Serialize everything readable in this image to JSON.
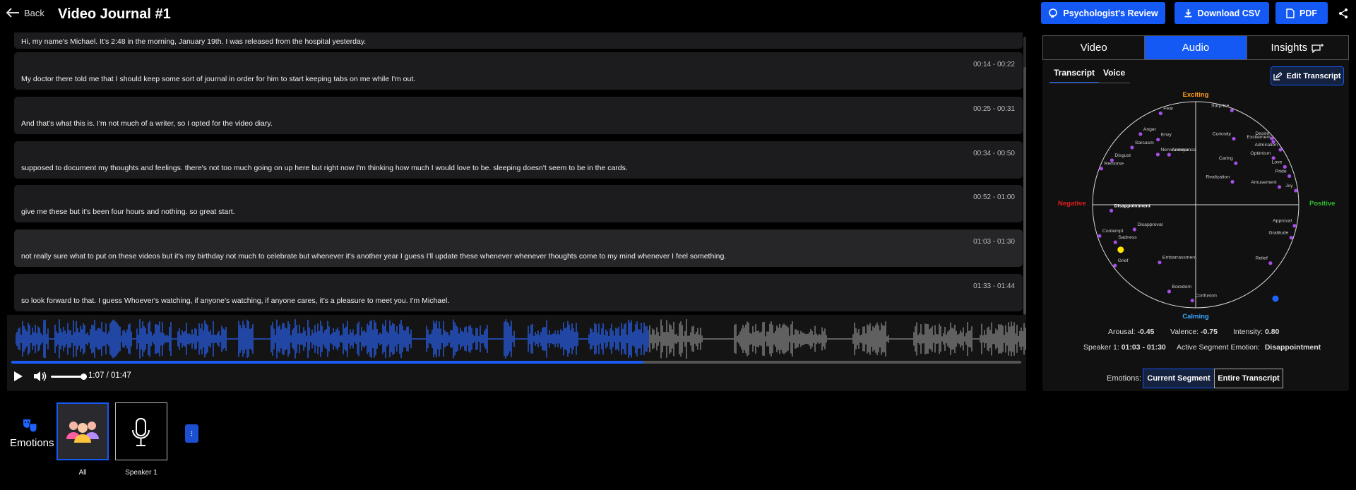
{
  "header": {
    "back_label": "Back",
    "title": "Video Journal #1",
    "psych_review_label": "Psychologist's Review",
    "download_csv_label": "Download CSV",
    "pdf_label": "PDF",
    "accent": "#1559f5"
  },
  "transcript": {
    "partial_line": "Hi, my name's Michael. It's 2:48 in the morning, January 19th. I was released from the hospital yesterday.",
    "segments": [
      {
        "time": "00:14 - 00:22",
        "text": "My doctor there told me that I should keep some sort of journal in order for him to start keeping tabs on me while I'm out."
      },
      {
        "time": "00:25 - 00:31",
        "text": "And that's what this is. I'm not much of a writer, so I opted for the video diary."
      },
      {
        "time": "00:34 - 00:50",
        "text": "supposed to document my thoughts and feelings. there's not too much going on up here but right now I'm thinking how much I would love to be. sleeping doesn't seem to be in the cards."
      },
      {
        "time": "00:52 - 01:00",
        "text": "give me these but it's been four hours and nothing. so great start."
      },
      {
        "time": "01:03 - 01:30",
        "text": "not really sure what to put on these videos but it's my birthday not much to celebrate but whenever it's another year I guess I'll update these whenever whenever thoughts come to my mind whenever I feel something."
      },
      {
        "time": "01:33 - 01:44",
        "text": "so look forward to that. I guess Whoever's watching, if anyone's watching, if anyone cares, it's a pleasure to meet you. I'm Michael."
      }
    ]
  },
  "player": {
    "time_readout": "1:07 / 01:47",
    "progress": 0.626,
    "volume": 0.9
  },
  "bottom": {
    "emotions_label": "Emotions",
    "thumbs": [
      {
        "caption": "All"
      },
      {
        "caption": "Speaker 1"
      }
    ],
    "more_label": "⁝"
  },
  "panel": {
    "tabs": [
      "Video",
      "Audio",
      "Insights"
    ],
    "subtabs": [
      "Transcript",
      "Voice"
    ],
    "edit_label": "Edit Transcript",
    "axis": {
      "top": "Exciting",
      "bottom": "Calming",
      "left": "Negative",
      "right": "Positive"
    },
    "emotions": [
      {
        "name": "Fear",
        "angle": 111,
        "r": 0.95
      },
      {
        "name": "Surprise",
        "angle": 69,
        "r": 0.98
      },
      {
        "name": "Anger",
        "angle": 128,
        "r": 0.87
      },
      {
        "name": "Envy",
        "angle": 120,
        "r": 0.73
      },
      {
        "name": "Curiosity",
        "angle": 60,
        "r": 0.74
      },
      {
        "name": "Desire",
        "angle": 41,
        "r": 0.98
      },
      {
        "name": "Sarcasm",
        "angle": 138,
        "r": 0.83
      },
      {
        "name": "Annoyance",
        "angle": 118,
        "r": 0.55
      },
      {
        "name": "Excitement",
        "angle": 39,
        "r": 0.97
      },
      {
        "name": "Nervousness",
        "angle": 127,
        "r": 0.61
      },
      {
        "name": "Admiration",
        "angle": 33,
        "r": 0.98
      },
      {
        "name": "Optimism",
        "angle": 31,
        "r": 0.88
      },
      {
        "name": "Disgust",
        "angle": 152,
        "r": 0.92
      },
      {
        "name": "Love",
        "angle": 23,
        "r": 0.94
      },
      {
        "name": "Remorse",
        "angle": 159,
        "r": 0.98
      },
      {
        "name": "Caring",
        "angle": 46,
        "r": 0.56
      },
      {
        "name": "Pride",
        "angle": 17,
        "r": 0.95
      },
      {
        "name": "Amusement",
        "angle": 12,
        "r": 0.83
      },
      {
        "name": "Realization",
        "angle": 32,
        "r": 0.42
      },
      {
        "name": "Joy",
        "angle": 8,
        "r": 0.98
      },
      {
        "name": "Disappointment",
        "angle": 184,
        "r": 0.82
      },
      {
        "name": "Disapproval",
        "angle": 202,
        "r": 0.64
      },
      {
        "name": "Approval",
        "angle": -12,
        "r": 0.98
      },
      {
        "name": "Contempt",
        "angle": 198,
        "r": 0.98
      },
      {
        "name": "Sadness",
        "angle": 205,
        "r": 0.86
      },
      {
        "name": "Gratitude",
        "angle": -19,
        "r": 0.98
      },
      {
        "name": "Embarrassment",
        "angle": 238,
        "r": 0.66
      },
      {
        "name": "Relief",
        "angle": -38,
        "r": 0.92
      },
      {
        "name": "Grief",
        "angle": 217,
        "r": 0.98
      },
      {
        "name": "Boredom",
        "angle": 253,
        "r": 0.88
      },
      {
        "name": "Confusion",
        "angle": 268,
        "r": 0.93
      }
    ],
    "active_emotion": "Disappointment",
    "marker": {
      "valence": -0.75,
      "arousal": -0.45
    },
    "arousal_label": "Arousal:",
    "arousal_value": "-0.45",
    "valence_label": "Valence:",
    "valence_value": "-0.75",
    "intensity_label": "Intensity:",
    "intensity_value": "0.80",
    "speaker_label": "Speaker 1:",
    "speaker_value": "01:03 - 01:30",
    "active_seg_label": "Active Segment Emotion:",
    "active_seg_value": "Disappointment",
    "emotions_label": "Emotions:",
    "toggle": [
      "Current Segment",
      "Entire Transcript"
    ],
    "point_color": "#a64ee8",
    "marker_color": "#ffe600",
    "exciting_color": "#ff9a1a",
    "calming_color": "#3aa8ff",
    "negative_color": "#e21c1c",
    "positive_color": "#2fbf2f",
    "info_icon": "info-icon"
  }
}
